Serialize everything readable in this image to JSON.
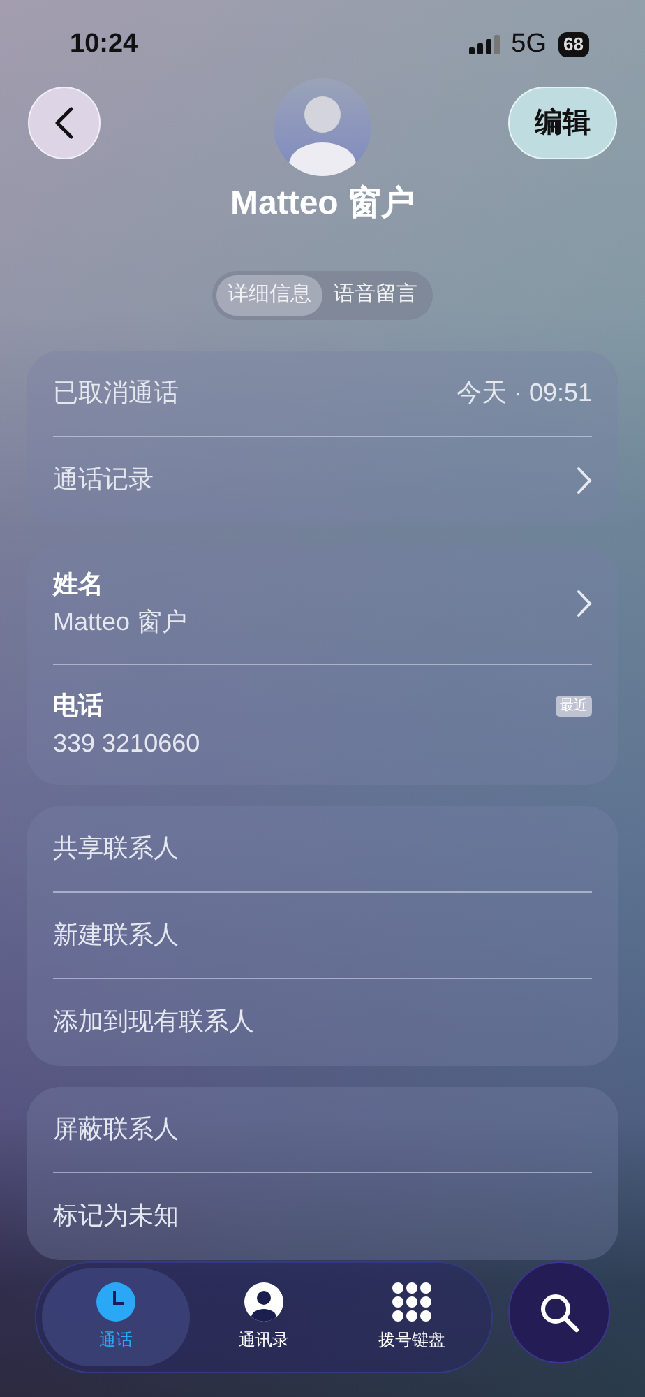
{
  "status_bar": {
    "time": "10:24",
    "network": "5G",
    "battery": "68"
  },
  "header": {
    "edit_button": "编辑"
  },
  "contact": {
    "name": "Matteo 窗户"
  },
  "segments": [
    {
      "label": "详细信息",
      "selected": true
    },
    {
      "label": "语音留言",
      "selected": false
    }
  ],
  "sections": [
    {
      "rows": [
        {
          "kind": "call",
          "label": "已取消通话",
          "detail": "今天 · 09:51"
        },
        {
          "kind": "link",
          "label": "通话记录",
          "chevron": true
        }
      ]
    },
    {
      "rows": [
        {
          "kind": "field",
          "label": "姓名",
          "value": "Matteo 窗户",
          "chevron": true
        },
        {
          "kind": "field",
          "label": "电话",
          "value": "339 3210660",
          "badge": "最近",
          "chevron": false
        }
      ]
    },
    {
      "rows": [
        {
          "kind": "action",
          "label": "共享联系人"
        },
        {
          "kind": "action",
          "label": "新建联系人"
        },
        {
          "kind": "action",
          "label": "添加到现有联系人"
        }
      ]
    },
    {
      "rows": [
        {
          "kind": "action",
          "label": "屏蔽联系人"
        },
        {
          "kind": "action",
          "label": "标记为未知"
        }
      ]
    }
  ],
  "tab_bar": {
    "tabs": [
      {
        "label": "通话",
        "selected": true
      },
      {
        "label": "通讯录",
        "selected": false
      },
      {
        "label": "拨号键盘",
        "selected": false
      }
    ]
  }
}
